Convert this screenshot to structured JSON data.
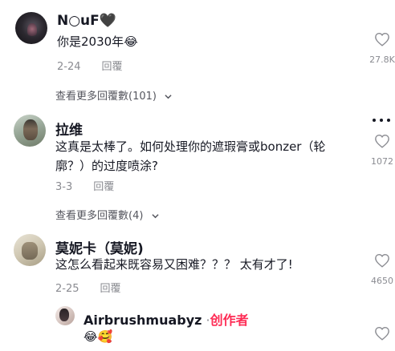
{
  "comments": [
    {
      "username": "N○uF",
      "username_suffix": "🖤",
      "text": "你是2030年",
      "text_emoji": "😂",
      "date": "2-24",
      "reply_label": "回覆",
      "likes": "27.8K",
      "view_more": "查看更多回覆數(101)"
    },
    {
      "username": "拉维",
      "text_line1": "这真是太棒了。如何处理你的遮瑕膏或bonzer（轮",
      "text_line2": "廓？）的过度喷涂?",
      "date": "3-3",
      "reply_label": "回覆",
      "likes": "1072",
      "view_more": "查看更多回覆數(4)"
    },
    {
      "username": "莫妮卡（莫妮)",
      "text": "这怎么看起来既容易又困难？？？ 太有才了!",
      "date": "2-25",
      "reply_label": "回覆",
      "likes": "4650"
    }
  ],
  "reply": {
    "username": "Airbrushmuabyz",
    "separator": " ·",
    "creator_badge": "创作者",
    "text_emoji": "😂🥰"
  },
  "icons": {
    "like": "heart-outline-icon",
    "more": "more-dots-icon",
    "expand": "chevron-down-icon"
  },
  "colors": {
    "text": "#161823",
    "muted": "#8a8b91",
    "creator": "#fe2c55"
  }
}
